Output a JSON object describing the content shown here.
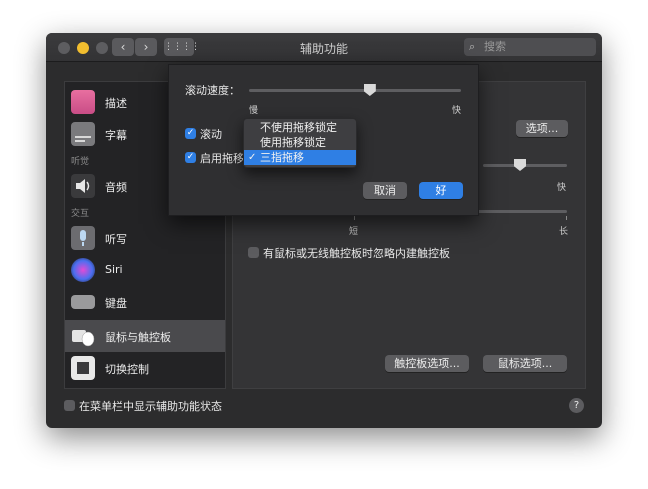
{
  "window": {
    "title": "辅助功能",
    "search_placeholder": "搜索"
  },
  "sidebar": {
    "items": [
      {
        "label": "描述",
        "icon": "description-icon"
      },
      {
        "label": "字幕",
        "icon": "captions-icon"
      },
      {
        "label": "音频",
        "icon": "audio-icon"
      },
      {
        "label": "听写",
        "icon": "dictation-icon"
      },
      {
        "label": "Siri",
        "icon": "siri-icon"
      },
      {
        "label": "键盘",
        "icon": "keyboard-icon"
      },
      {
        "label": "鼠标与触控板",
        "icon": "mouse-trackpad-icon"
      },
      {
        "label": "切换控制",
        "icon": "switch-control-icon"
      }
    ],
    "sections": {
      "hearing": "听觉",
      "interaction": "交互"
    }
  },
  "main": {
    "desc_tail": "计。",
    "options_button": "选项...",
    "fast_label": "快",
    "short_label": "短",
    "long_label": "长",
    "ignore_trackpad_label": "有鼠标或无线触控板时忽略内建触控板",
    "ignore_trackpad_checked": false,
    "trackpad_options_button": "触控板选项...",
    "mouse_options_button": "鼠标选项..."
  },
  "sheet": {
    "scroll_speed_label": "滚动速度：",
    "slow_label": "慢",
    "fast_label": "快",
    "scroll_speed_value": 0.57,
    "scroll_label": "滚动",
    "scroll_checked": true,
    "drag_label": "启用拖移",
    "drag_checked": true,
    "cancel_button": "取消",
    "ok_button": "好",
    "drag_menu": {
      "options": [
        "不使用拖移锁定",
        "使用拖移锁定",
        "三指拖移"
      ],
      "selected": "三指拖移"
    }
  },
  "footer": {
    "show_status_label": "在菜单栏中显示辅助功能状态",
    "show_status_checked": false,
    "help": "?"
  },
  "colors": {
    "accent": "#2f7fe4",
    "window_bg": "#2c2c2d",
    "sidebar_selected": "#4a4a4d"
  }
}
